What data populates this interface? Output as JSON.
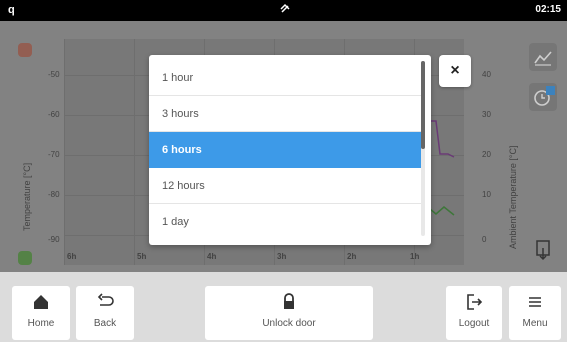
{
  "status_bar": {
    "left": "q",
    "time": "02:15"
  },
  "chart": {
    "y_ticks_left": [
      "-50",
      "-60",
      "-70",
      "-80",
      "-90"
    ],
    "y_ticks_right": [
      "40",
      "30",
      "20",
      "10",
      "0"
    ],
    "x_ticks": [
      "6h",
      "5h",
      "4h",
      "3h",
      "2h",
      "1h"
    ],
    "y_label_left": "Temperature [°C]",
    "y_label_right": "Ambient Temperature [°C]"
  },
  "dialog": {
    "options": [
      "1 hour",
      "3 hours",
      "6 hours",
      "12 hours",
      "1 day"
    ],
    "selected_index": 2,
    "close_label": "×"
  },
  "bottom_bar": {
    "home": "Home",
    "back": "Back",
    "unlock": "Unlock door",
    "logout": "Logout",
    "menu": "Menu"
  },
  "colors": {
    "accent": "#3d9ae8",
    "purple_line": "#7a3a8a",
    "green_line": "#3f8a3a"
  }
}
